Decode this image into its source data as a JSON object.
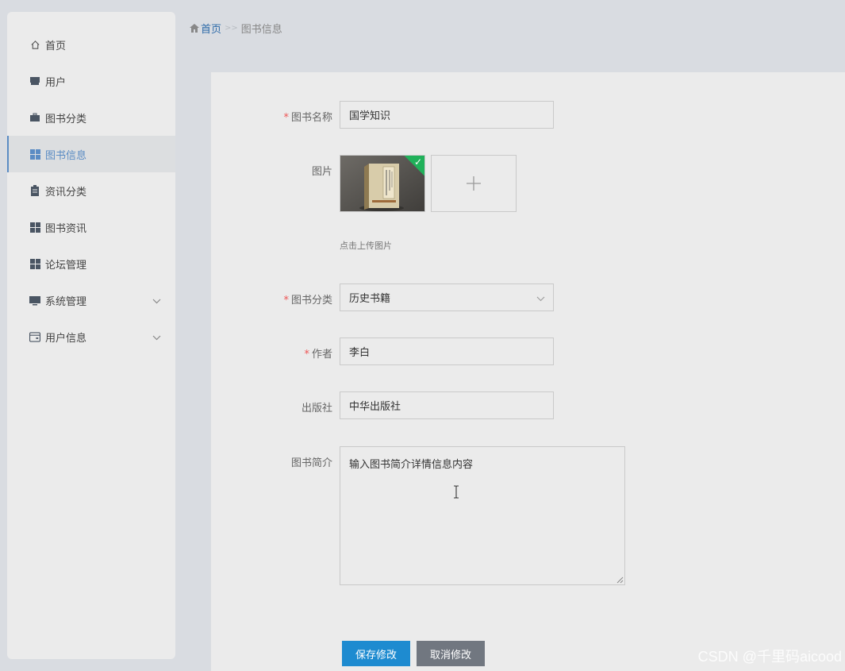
{
  "sidebar": {
    "items": [
      {
        "label": "首页",
        "icon": "home-icon"
      },
      {
        "label": "用户",
        "icon": "user-icon"
      },
      {
        "label": "图书分类",
        "icon": "briefcase-icon"
      },
      {
        "label": "图书信息",
        "icon": "grid-icon",
        "active": true
      },
      {
        "label": "资讯分类",
        "icon": "clipboard-icon"
      },
      {
        "label": "图书资讯",
        "icon": "grid-icon"
      },
      {
        "label": "论坛管理",
        "icon": "grid-icon"
      },
      {
        "label": "系统管理",
        "icon": "monitor-icon",
        "expandable": true
      },
      {
        "label": "用户信息",
        "icon": "card-icon",
        "expandable": true
      }
    ]
  },
  "breadcrumb": {
    "home": "首页",
    "separator": ">>",
    "current": "图书信息"
  },
  "form": {
    "name": {
      "label": "图书名称",
      "value": "国学知识",
      "required": true
    },
    "image": {
      "label": "图片",
      "upload_hint": "点击上传图片"
    },
    "category": {
      "label": "图书分类",
      "value": "历史书籍",
      "required": true
    },
    "author": {
      "label": "作者",
      "value": "李白",
      "required": true
    },
    "publisher": {
      "label": "出版社",
      "value": "中华出版社"
    },
    "intro": {
      "label": "图书简介",
      "value": "输入图书简介详情信息内容"
    }
  },
  "buttons": {
    "save": "保存修改",
    "cancel": "取消修改"
  },
  "colors": {
    "accent": "#1e8bd0",
    "active_nav": "#5b8cc4",
    "success": "#20b15a",
    "required": "#ee5555"
  },
  "watermark": "CSDN @千里码aicood"
}
